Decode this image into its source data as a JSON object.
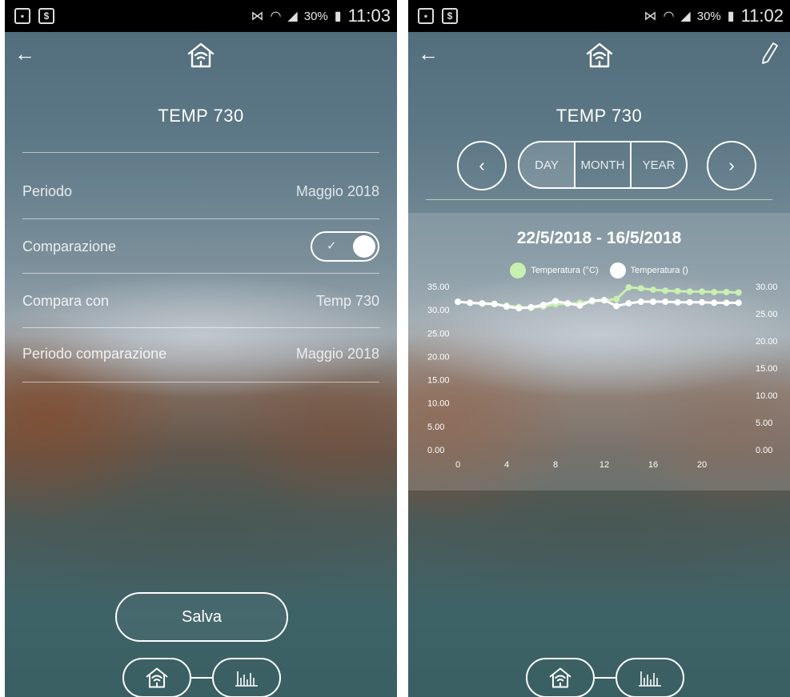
{
  "status_bar": {
    "left_battery": "30%",
    "left_time": "11:03",
    "right_battery": "30%",
    "right_time": "11:02"
  },
  "left_screen": {
    "title": "TEMP 730",
    "rows": [
      {
        "label": "Periodo",
        "value": "Maggio 2018"
      },
      {
        "label": "Comparazione",
        "toggle_on": true
      },
      {
        "label": "Compara con",
        "value": "Temp 730"
      },
      {
        "label": "Periodo comparazione",
        "value": "Maggio 2018"
      }
    ],
    "save_label": "Salva"
  },
  "right_screen": {
    "title": "TEMP 730",
    "segments": [
      "DAY",
      "MONTH",
      "YEAR"
    ],
    "active_segment": "DAY",
    "date_range": "22/5/2018 - 16/5/2018"
  },
  "icons": {
    "back": "arrow-left-icon",
    "home": "home-wifi-icon",
    "edit": "pencil-icon",
    "chart": "bar-chart-icon",
    "prev": "chevron-left-icon",
    "next": "chevron-right-icon"
  },
  "chart_data": {
    "type": "line",
    "title": "22/5/2018 - 16/5/2018",
    "x": [
      0,
      1,
      2,
      3,
      4,
      5,
      6,
      7,
      8,
      9,
      10,
      11,
      12,
      13,
      14,
      15,
      16,
      17,
      18,
      19,
      20,
      21,
      22,
      23
    ],
    "x_ticks": [
      0,
      4,
      8,
      12,
      16,
      20
    ],
    "y_left_ticks": [
      "0.00",
      "5.00",
      "10.00",
      "15.00",
      "20.00",
      "25.00",
      "30.00",
      "35.00"
    ],
    "y_left_lim": [
      0,
      35
    ],
    "y_right_ticks": [
      "0.00",
      "5.00",
      "10.00",
      "15.00",
      "20.00",
      "25.00",
      "30.00"
    ],
    "y_right_lim": [
      0,
      30
    ],
    "series": [
      {
        "name": "Temperatura (°C)",
        "axis": "left",
        "color": "#c8f0b0",
        "values": [
          31.7,
          31.5,
          31.3,
          31.2,
          30.9,
          30.6,
          30.4,
          30.7,
          31.2,
          31.3,
          31.5,
          31.8,
          32.0,
          32.3,
          34.8,
          34.6,
          34.3,
          34.1,
          34.0,
          33.9,
          33.9,
          33.8,
          33.8,
          33.7
        ]
      },
      {
        "name": "Temperatura ()",
        "axis": "right",
        "color": "#ffffff",
        "values": [
          27.2,
          27.0,
          26.9,
          26.8,
          26.3,
          26.0,
          26.2,
          26.6,
          27.3,
          26.9,
          26.5,
          27.4,
          27.5,
          26.4,
          26.9,
          27.2,
          27.2,
          27.2,
          27.1,
          27.1,
          27.1,
          27.0,
          27.0,
          27.0
        ]
      }
    ],
    "grid": false,
    "legend_position": "top-center"
  }
}
